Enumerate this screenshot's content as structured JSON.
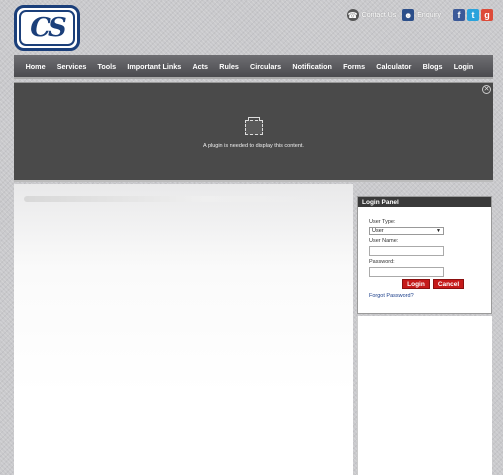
{
  "logo": {
    "text": "CS"
  },
  "top_links": {
    "contact_label": "Contact Us",
    "contact_icon": "phone-icon",
    "enquiry_label": "Enquiry",
    "enquiry_icon": "enquiry-person-icon",
    "social": [
      "facebook-icon",
      "twitter-icon",
      "google-icon"
    ]
  },
  "nav": {
    "items": [
      "Home",
      "Services",
      "Tools",
      "Important Links",
      "Acts",
      "Rules",
      "Circulars",
      "Notification",
      "Forms",
      "Calculator",
      "Blogs",
      "Login"
    ]
  },
  "banner": {
    "plugin_message": "A plugin is needed to display this content.",
    "close_symbol": "✕"
  },
  "login_panel": {
    "title": "Login Panel",
    "user_type_label": "User Type:",
    "user_type_value": "User",
    "user_name_label": "User Name:",
    "password_label": "Password:",
    "login_button": "Login",
    "cancel_button": "Cancel",
    "forgot_link": "Forgot Password?"
  },
  "colors": {
    "brand_blue": "#1b3f7a",
    "nav_bg": "#5a5a5e",
    "button_red": "#c51a1a"
  }
}
